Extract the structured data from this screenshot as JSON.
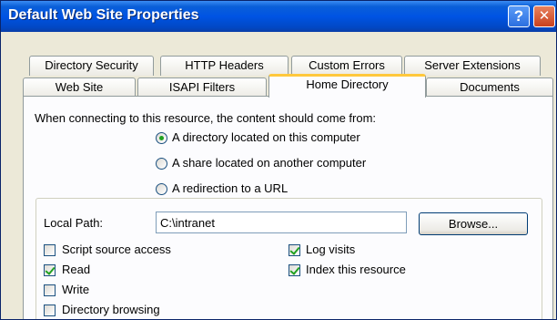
{
  "window": {
    "title": "Default Web Site Properties",
    "help_glyph": "?",
    "close_glyph": "✕"
  },
  "tabs": {
    "row_back": [
      {
        "label": "Directory Security"
      },
      {
        "label": "HTTP Headers"
      },
      {
        "label": "Custom Errors"
      },
      {
        "label": "Server Extensions"
      }
    ],
    "row_front": [
      {
        "label": "Web Site"
      },
      {
        "label": "ISAPI Filters"
      },
      {
        "label": "Home Directory",
        "active": true
      },
      {
        "label": "Documents"
      }
    ]
  },
  "content_source": {
    "prompt": "When connecting to this resource, the content should come from:",
    "options": [
      {
        "label": "A directory located on this computer",
        "selected": true
      },
      {
        "label": "A share located on another computer",
        "selected": false
      },
      {
        "label": "A redirection to a URL",
        "selected": false
      }
    ]
  },
  "local_path": {
    "label": "Local Path:",
    "value": "C:\\intranet",
    "browse_label": "Browse..."
  },
  "permissions": {
    "left": [
      {
        "label": "Script source access",
        "checked": false
      },
      {
        "label": "Read",
        "checked": true
      },
      {
        "label": "Write",
        "checked": false
      },
      {
        "label": "Directory browsing",
        "checked": false
      }
    ],
    "right": [
      {
        "label": "Log visits",
        "checked": true
      },
      {
        "label": "Index this resource",
        "checked": true
      }
    ]
  }
}
